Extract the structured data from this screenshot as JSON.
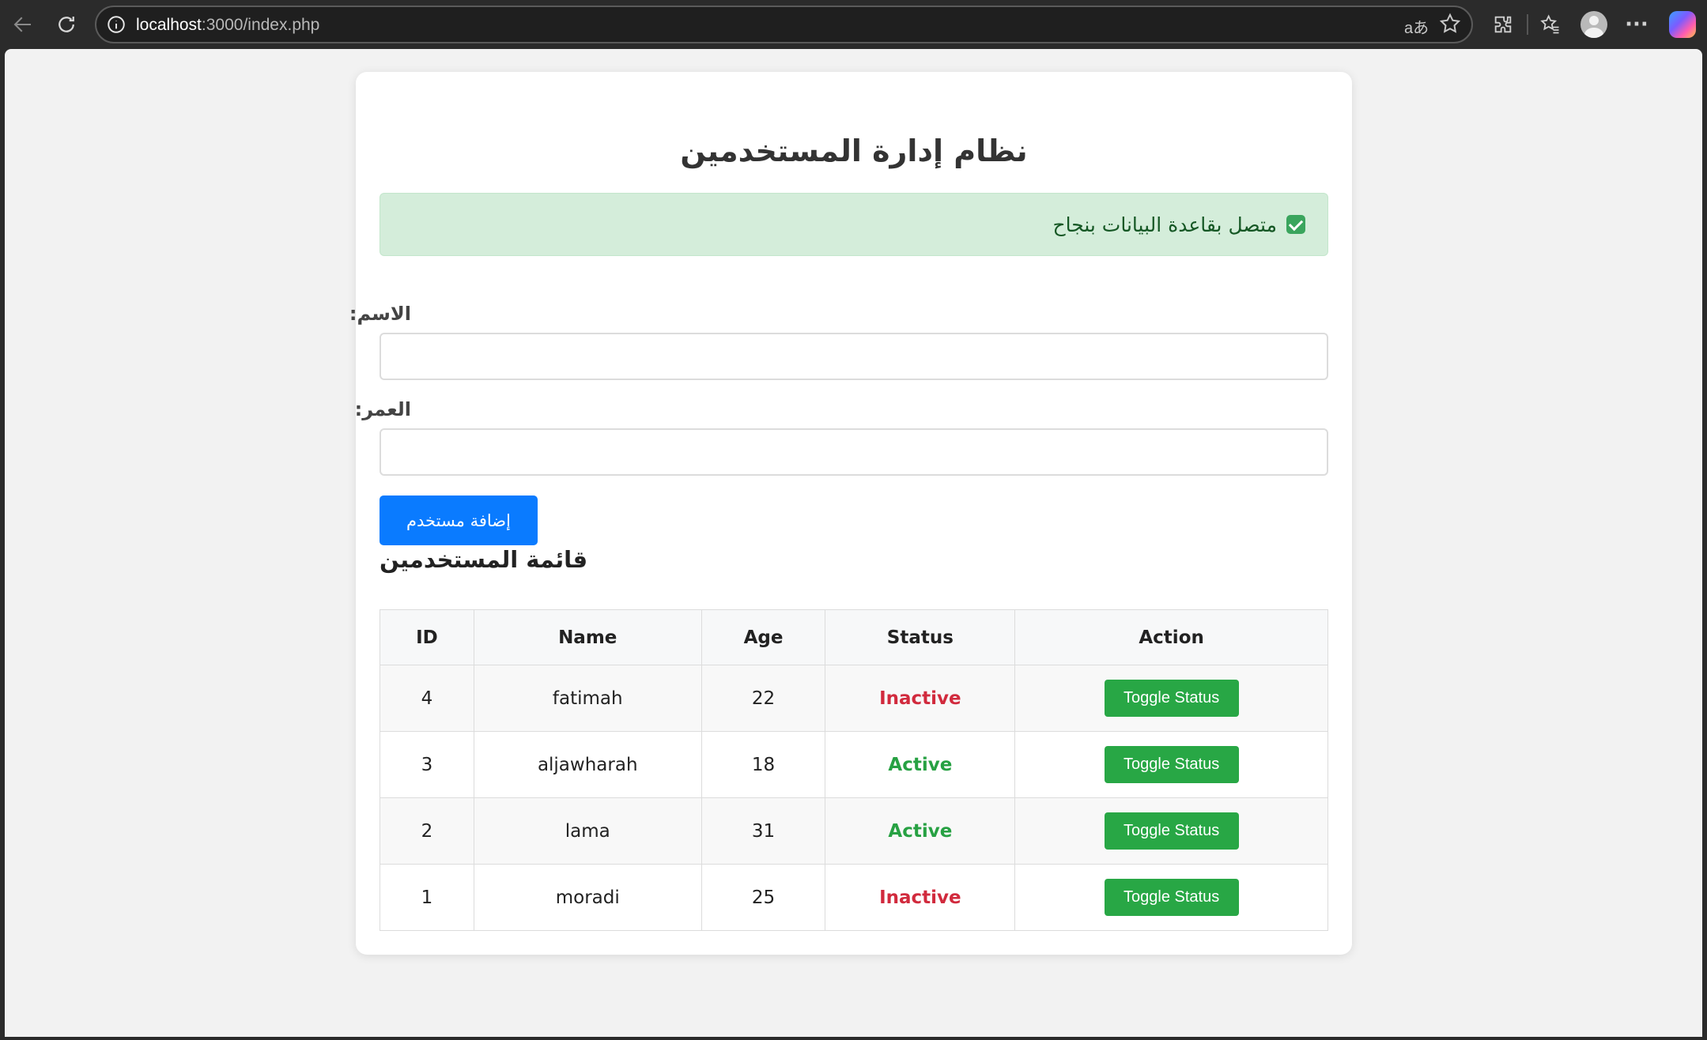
{
  "browser": {
    "url_host": "localhost",
    "url_rest": ":3000/index.php"
  },
  "page": {
    "title": "نظام إدارة المستخدمين",
    "alert_text": "متصل بقاعدة البيانات بنجاح",
    "name_label": "الاسم:",
    "age_label": "العمر:",
    "name_value": "",
    "age_value": "",
    "add_button": "إضافة مستخدم",
    "list_title": "قائمة المستخدمين"
  },
  "table": {
    "headers": [
      "ID",
      "Name",
      "Age",
      "Status",
      "Action"
    ],
    "rows": [
      {
        "id": "4",
        "name": "fatimah",
        "age": "22",
        "status": "Inactive",
        "action": "Toggle Status"
      },
      {
        "id": "3",
        "name": "aljawharah",
        "age": "18",
        "status": "Active",
        "action": "Toggle Status"
      },
      {
        "id": "2",
        "name": "lama",
        "age": "31",
        "status": "Active",
        "action": "Toggle Status"
      },
      {
        "id": "1",
        "name": "moradi",
        "age": "25",
        "status": "Inactive",
        "action": "Toggle Status"
      }
    ]
  },
  "colors": {
    "primary": "#0a7bff",
    "success": "#28a745",
    "danger": "#d12a3d",
    "alert_bg": "#d4edda"
  },
  "icons": [
    "back-icon",
    "reload-icon",
    "info-icon",
    "read-aloud-icon",
    "favorite-star-icon",
    "extensions-icon",
    "favorites-icon",
    "profile-avatar-icon",
    "more-icon",
    "copilot-icon",
    "check-icon"
  ]
}
